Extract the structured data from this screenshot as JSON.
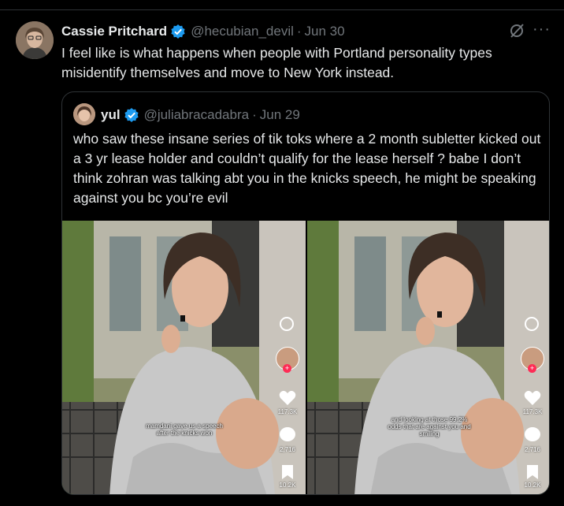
{
  "tweet": {
    "author_name": "Cassie Pritchard",
    "author_handle": "@hecubian_devil",
    "separator": "·",
    "date": "Jun 30",
    "text": "I feel like is what happens when people with Portland personality types misidentify themselves and move to New York instead.",
    "more_label": "···"
  },
  "quote": {
    "author_name": "yul",
    "author_handle": "@juliabracadabra",
    "separator": "·",
    "date": "Jun 29",
    "text": "who saw these insane series of tik toks where a 2 month subletter kicked out a 3 yr lease holder and couldn’t qualify for the lease herself ? babe I don’t think zohran was talking abt you in the knicks speech, he might be speaking against you bc you’re evil"
  },
  "media": [
    {
      "caption": "mamdani gave us a speech after the knicks won",
      "likes": "117.3K",
      "comments": "2,716",
      "saves": "10.2K"
    },
    {
      "caption": "and looking at those 99.2% odds that are against you and smiling",
      "likes": "117.3K",
      "comments": "2,716",
      "saves": "10.2K"
    }
  ],
  "colors": {
    "background": "#000000",
    "text": "#e7e9ea",
    "muted": "#71767b",
    "verified": "#1d9bf0",
    "border": "#2f3336"
  }
}
